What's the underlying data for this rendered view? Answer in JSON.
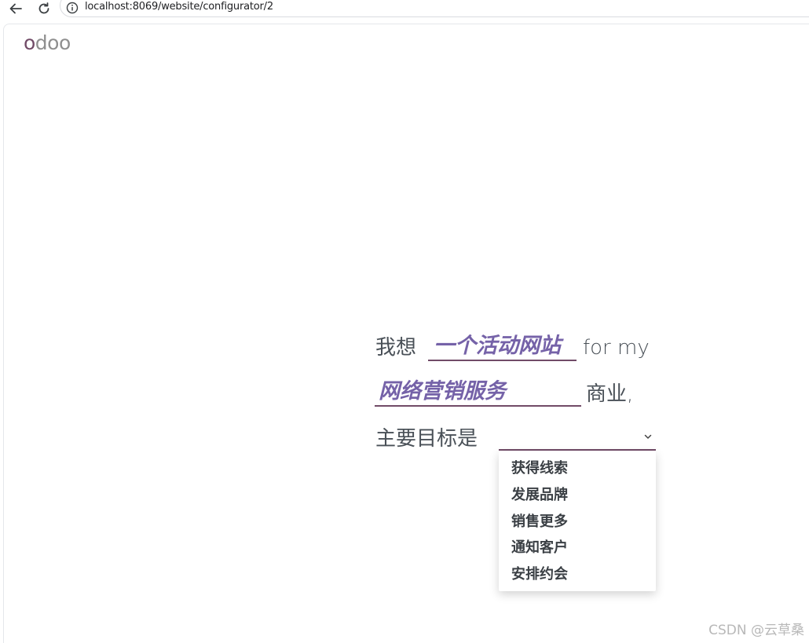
{
  "browser": {
    "url": "localhost:8069/website/configurator/2"
  },
  "logo": {
    "first": "o",
    "rest": "doo"
  },
  "configurator": {
    "line1_prefix": "我想",
    "website_type": "一个活动网站",
    "line1_suffix": "for my",
    "business_type": "网络营销服务",
    "line2_suffix": "商业,",
    "line3_prefix": "主要目标是",
    "goal_value": ""
  },
  "goal_options": [
    "获得线索",
    "发展品牌",
    "销售更多",
    "通知客户",
    "安排约会"
  ],
  "watermark": "CSDN @云草桑",
  "colors": {
    "brand": "#714b67",
    "accent": "#7562a8"
  }
}
